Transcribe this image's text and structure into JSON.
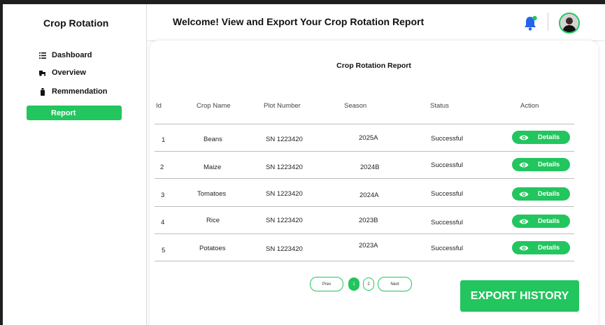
{
  "sidebar": {
    "app_title": "Crop Rotation",
    "items": [
      {
        "label": "Dashboard",
        "icon": "list-icon"
      },
      {
        "label": "Overview",
        "icon": "tractor-icon"
      },
      {
        "label": "Remmendation",
        "icon": "bottle-icon"
      },
      {
        "label": "Report",
        "icon": "",
        "active": true
      }
    ]
  },
  "header": {
    "title": "Welcome!  View and Export Your Crop Rotation Report",
    "bell_icon": "bell-icon",
    "avatar": "user-avatar"
  },
  "report": {
    "title": "Crop Rotation Report",
    "columns": [
      "Id",
      "Crop Name",
      "Plot Number",
      "Season",
      "Status",
      "Action"
    ],
    "rows": [
      {
        "id": "1",
        "crop": "Beans",
        "plot": "SN 1223420",
        "season": "2025A",
        "status": "Successful",
        "action": "Details"
      },
      {
        "id": "2",
        "crop": "Maize",
        "plot": "SN 1223420",
        "season": "2024B",
        "status": "Successful",
        "action": "Details"
      },
      {
        "id": "3",
        "crop": "Tomatoes",
        "plot": "SN 1223420",
        "season": "2024A",
        "status": "Successful",
        "action": "Details"
      },
      {
        "id": "4",
        "crop": "Rice",
        "plot": "SN 1223420",
        "season": "2023B",
        "status": "Successful",
        "action": "Details"
      },
      {
        "id": "5",
        "crop": "Potatoes",
        "plot": "SN 1223420",
        "season": "2023A",
        "status": "Successful",
        "action": "Details"
      }
    ]
  },
  "pagination": {
    "prev": "Prev",
    "pages": [
      "1",
      "2"
    ],
    "current": "1",
    "next": "Next"
  },
  "export_label": "EXPORT HISTORY",
  "colors": {
    "accent": "#22c55e",
    "bell": "#2563eb",
    "bell_dot": "#22c55e"
  }
}
